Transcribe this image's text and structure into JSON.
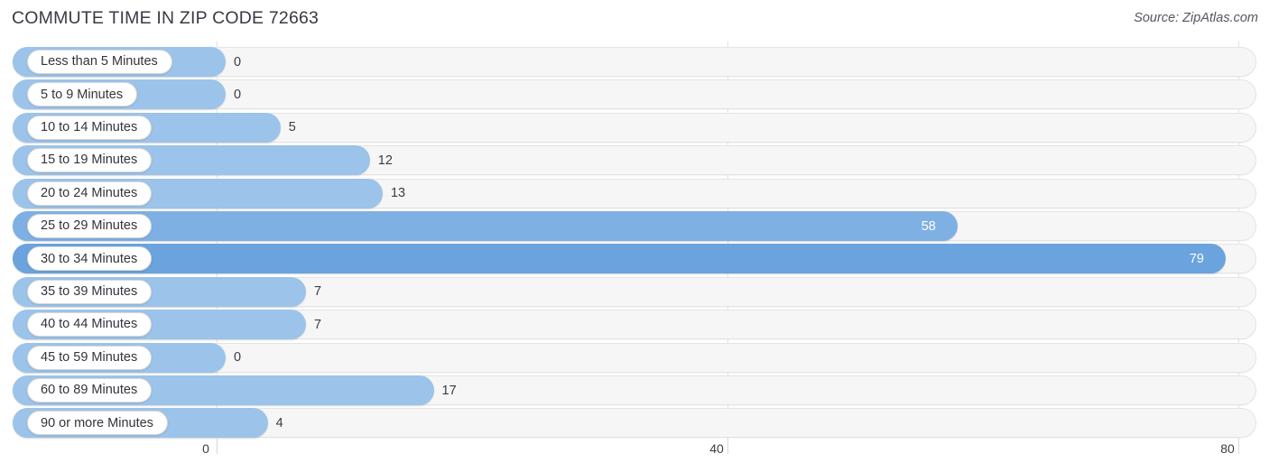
{
  "header": {
    "title": "COMMUTE TIME IN ZIP CODE 72663",
    "source": "Source: ZipAtlas.com"
  },
  "colors": {
    "bar_light": "#9cc3e9",
    "bar_mid": "#7fb0e3",
    "bar_dark": "#6aa3dd",
    "track": "#f6f6f6",
    "track_border": "#e4e4e4",
    "gridline": "#e3e3e3",
    "text": "#33333c"
  },
  "chart_data": {
    "type": "bar",
    "orientation": "horizontal",
    "title": "COMMUTE TIME IN ZIP CODE 72663",
    "source": "Source: ZipAtlas.com",
    "xlabel": "",
    "ylabel": "",
    "xlim": [
      0,
      80
    ],
    "grid": true,
    "legend": "none",
    "tick_labels": [
      "0",
      "40",
      "80"
    ],
    "tick_values": [
      0,
      40,
      80
    ],
    "categories": [
      "Less than 5 Minutes",
      "5 to 9 Minutes",
      "10 to 14 Minutes",
      "15 to 19 Minutes",
      "20 to 24 Minutes",
      "25 to 29 Minutes",
      "30 to 34 Minutes",
      "35 to 39 Minutes",
      "40 to 44 Minutes",
      "45 to 59 Minutes",
      "60 to 89 Minutes",
      "90 or more Minutes"
    ],
    "values": [
      0,
      0,
      5,
      12,
      13,
      58,
      79,
      7,
      7,
      0,
      17,
      4
    ],
    "value_labels": [
      "0",
      "0",
      "5",
      "12",
      "13",
      "58",
      "79",
      "7",
      "7",
      "0",
      "17",
      "4"
    ]
  },
  "rows": [
    {
      "label": "Less than 5 Minutes",
      "value": 0,
      "value_label": "0",
      "label_inside": false,
      "shade": "light"
    },
    {
      "label": "5 to 9 Minutes",
      "value": 0,
      "value_label": "0",
      "label_inside": false,
      "shade": "light"
    },
    {
      "label": "10 to 14 Minutes",
      "value": 5,
      "value_label": "5",
      "label_inside": false,
      "shade": "light"
    },
    {
      "label": "15 to 19 Minutes",
      "value": 12,
      "value_label": "12",
      "label_inside": false,
      "shade": "light"
    },
    {
      "label": "20 to 24 Minutes",
      "value": 13,
      "value_label": "13",
      "label_inside": false,
      "shade": "light"
    },
    {
      "label": "25 to 29 Minutes",
      "value": 58,
      "value_label": "58",
      "label_inside": true,
      "shade": "mid"
    },
    {
      "label": "30 to 34 Minutes",
      "value": 79,
      "value_label": "79",
      "label_inside": true,
      "shade": "dark"
    },
    {
      "label": "35 to 39 Minutes",
      "value": 7,
      "value_label": "7",
      "label_inside": false,
      "shade": "light"
    },
    {
      "label": "40 to 44 Minutes",
      "value": 7,
      "value_label": "7",
      "label_inside": false,
      "shade": "light"
    },
    {
      "label": "45 to 59 Minutes",
      "value": 0,
      "value_label": "0",
      "label_inside": false,
      "shade": "light"
    },
    {
      "label": "60 to 89 Minutes",
      "value": 17,
      "value_label": "17",
      "label_inside": false,
      "shade": "light"
    },
    {
      "label": "90 or more Minutes",
      "value": 4,
      "value_label": "4",
      "label_inside": false,
      "shade": "light"
    }
  ],
  "axis": {
    "ticks": [
      {
        "label": "0",
        "value": 0
      },
      {
        "label": "40",
        "value": 40
      },
      {
        "label": "80",
        "value": 80
      }
    ]
  }
}
